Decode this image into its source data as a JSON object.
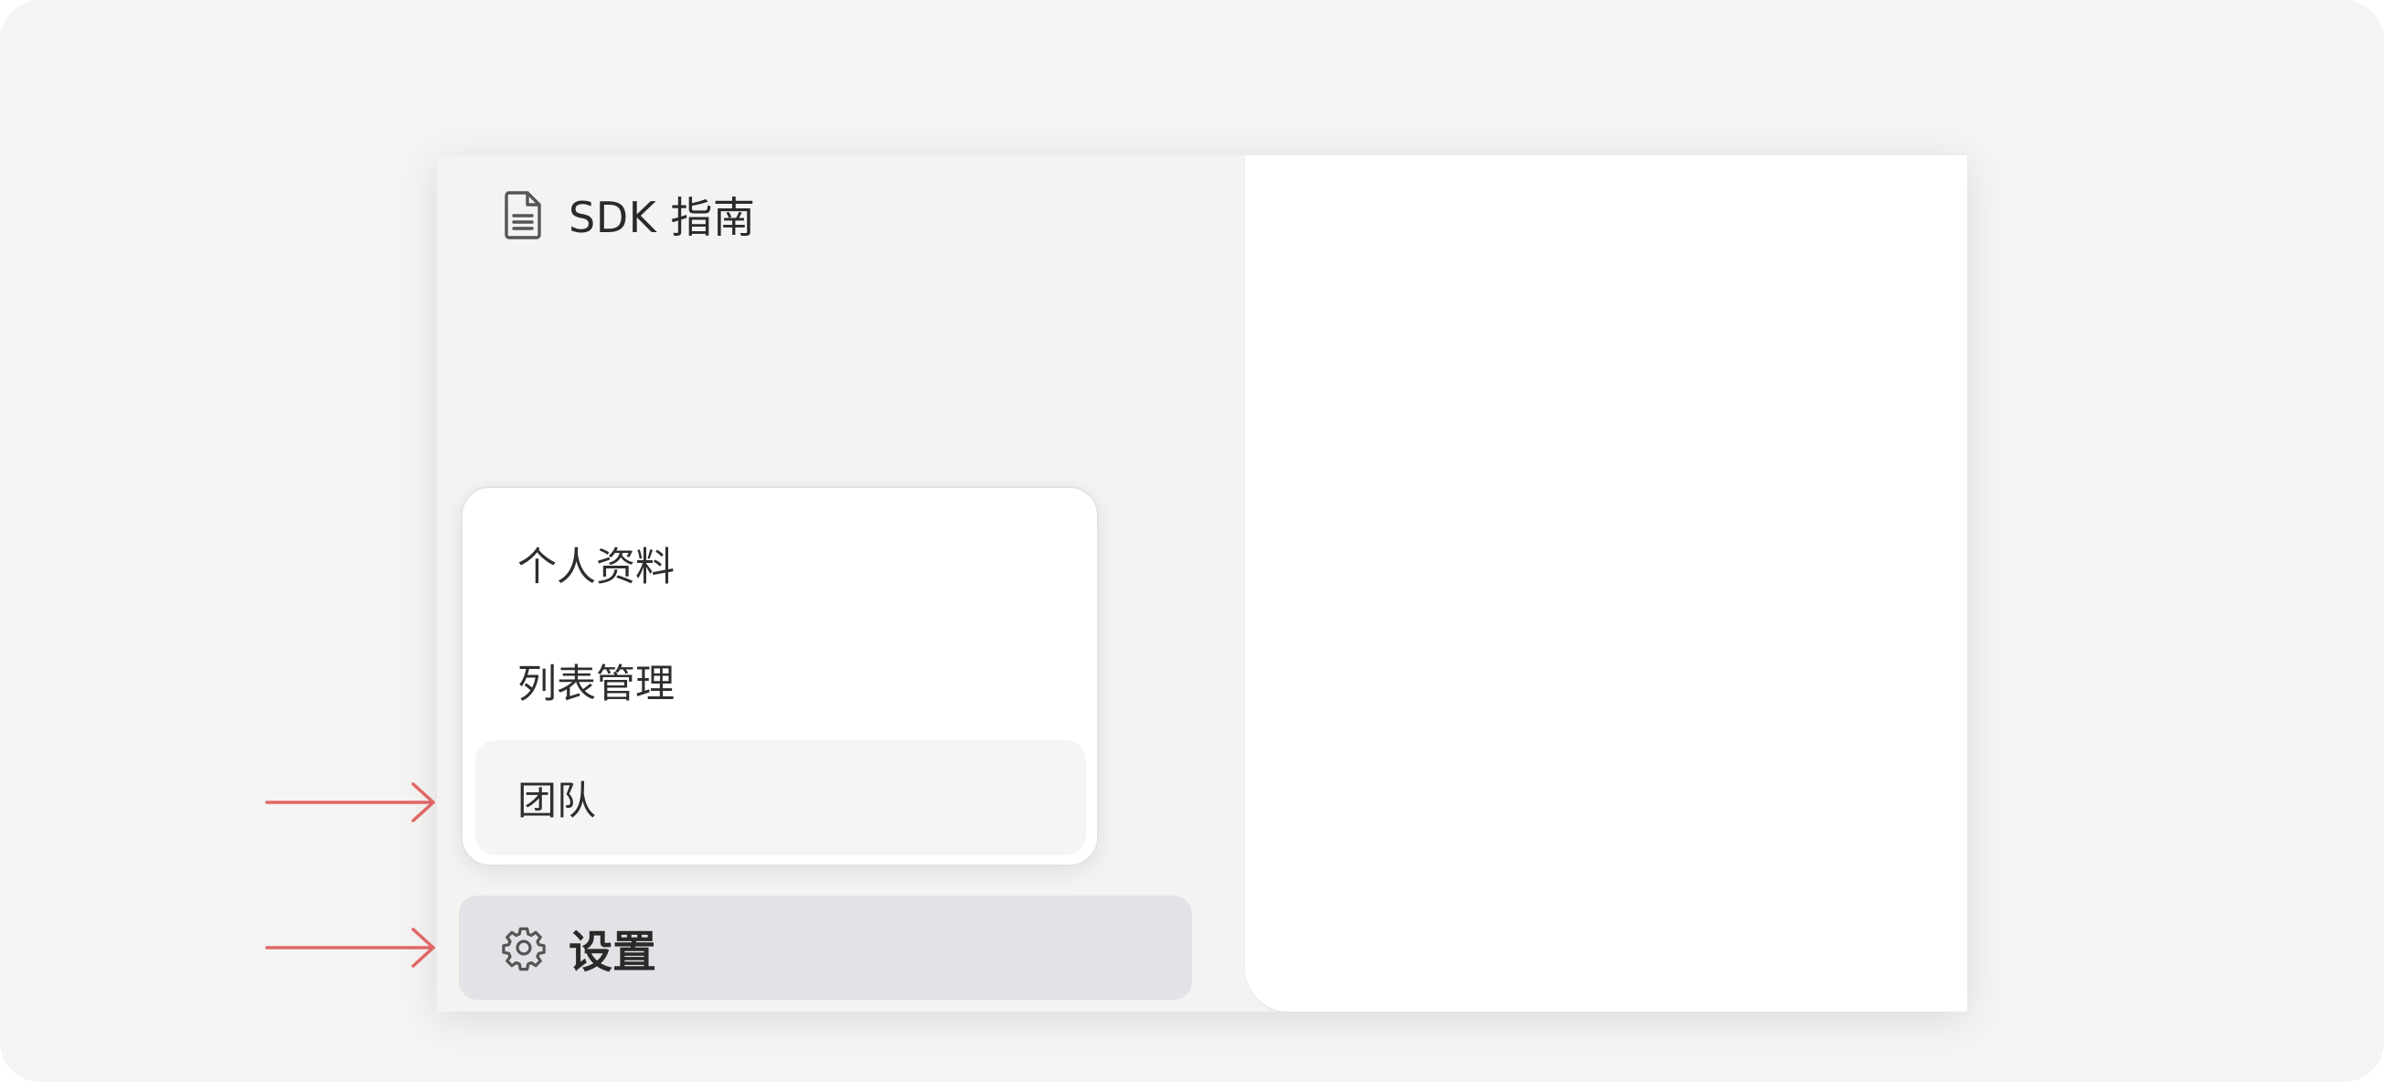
{
  "sidebar": {
    "doc_item": {
      "icon": "document-icon",
      "label": "SDK 指南"
    },
    "settings": {
      "icon": "gear-icon",
      "label": "设置"
    }
  },
  "menu": {
    "items": [
      {
        "label": "个人资料"
      },
      {
        "label": "列表管理"
      },
      {
        "label": "团队",
        "highlighted": true
      }
    ]
  },
  "annotations": {
    "arrow_color": "#e06666"
  },
  "colors": {
    "background": "#f5f4f2",
    "sidebar": "#f4f3f1",
    "settings_active": "#e4e2e6",
    "menu_hover": "#f5f5f5",
    "content": "#ffffff"
  }
}
